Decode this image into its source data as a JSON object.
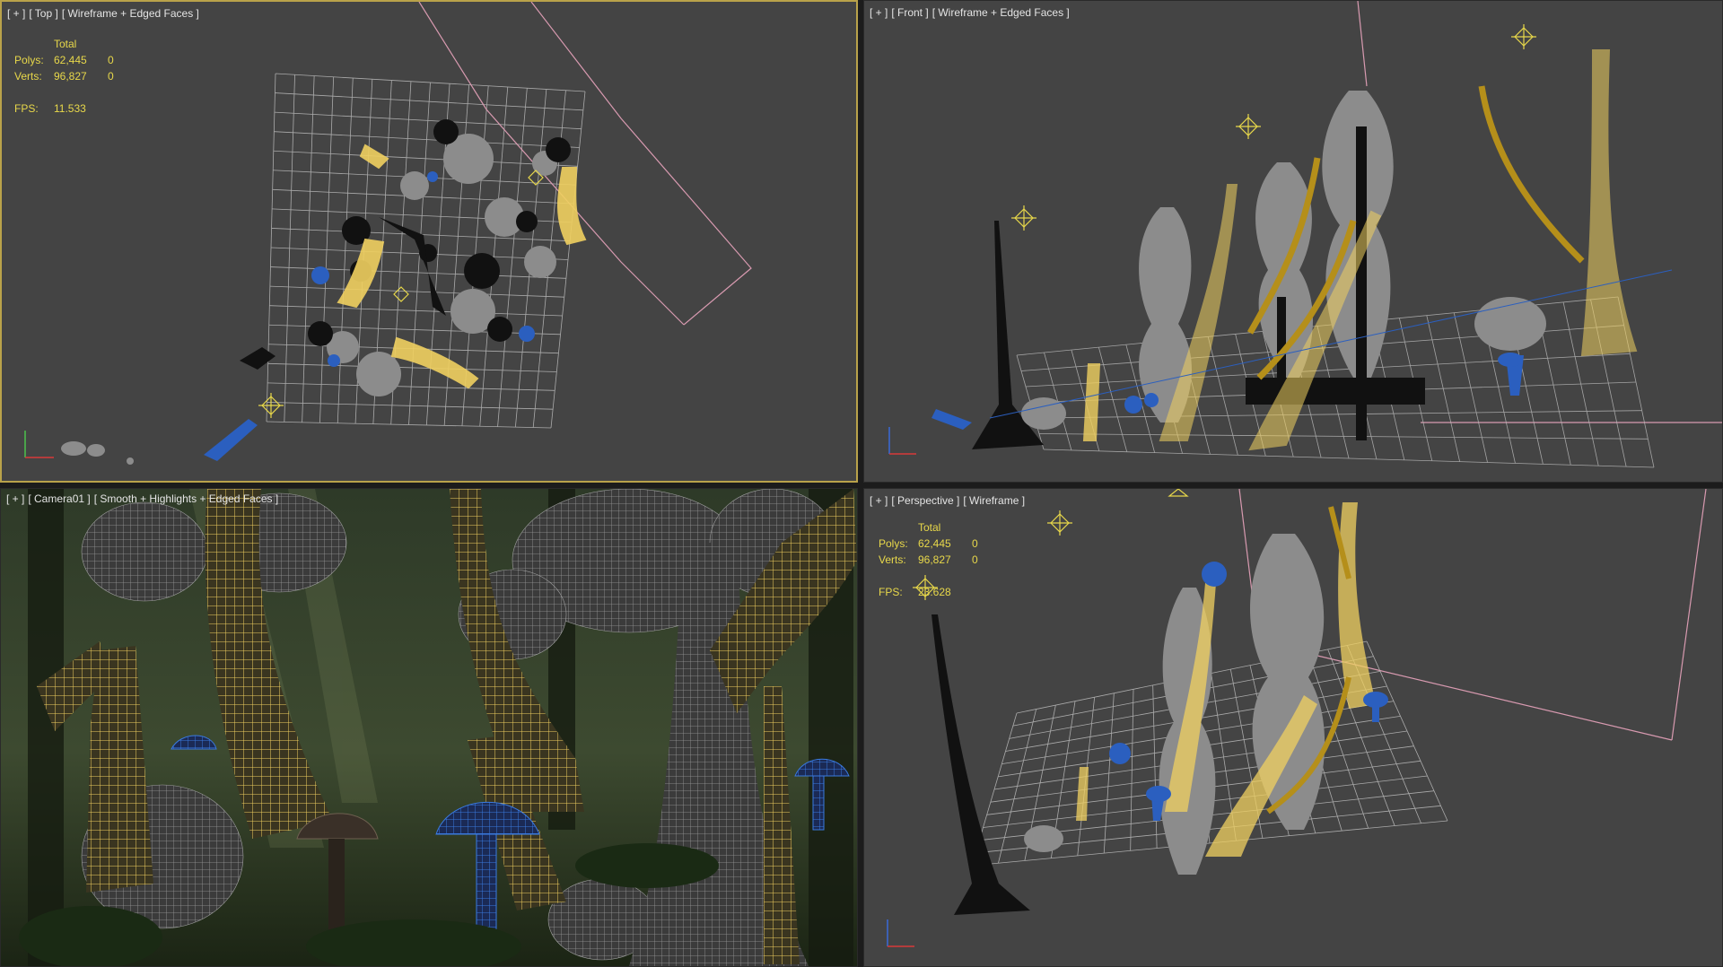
{
  "viewports": {
    "top": {
      "plus": "[ + ]",
      "view": "[ Top ]",
      "shading": "[ Wireframe + Edged Faces ]"
    },
    "front": {
      "plus": "[ + ]",
      "view": "[ Front ]",
      "shading": "[ Wireframe + Edged Faces ]"
    },
    "camera": {
      "plus": "[ + ]",
      "view": "[ Camera01 ]",
      "shading": "[ Smooth + Highlights + Edged Faces ]"
    },
    "perspective": {
      "plus": "[ + ]",
      "view": "[ Perspective ]",
      "shading": "[ Wireframe ]"
    }
  },
  "stats_top": {
    "header": "Total",
    "polys_label": "Polys:",
    "polys_value": "62,445",
    "polys_sel": "0",
    "verts_label": "Verts:",
    "verts_value": "96,827",
    "verts_sel": "0",
    "fps_label": "FPS:",
    "fps_value": "11.533"
  },
  "stats_persp": {
    "header": "Total",
    "polys_label": "Polys:",
    "polys_value": "62,445",
    "polys_sel": "0",
    "verts_label": "Verts:",
    "verts_value": "96,827",
    "verts_sel": "0",
    "fps_label": "FPS:",
    "fps_value": "23.628"
  },
  "colors": {
    "viewport_bg": "#444444",
    "active_border": "#b9a24a",
    "wire_yellow": "#f0d060",
    "wire_gold": "#b58f1a",
    "wire_gray": "#8c8c8c",
    "wire_blue": "#2b5fbf",
    "grid": "#bdbdbd",
    "camera_pink": "#d89ab0",
    "stats_text": "#e8d84a"
  },
  "icons": [
    "axis-tripod-icon",
    "camera-target-icon",
    "light-icon"
  ]
}
